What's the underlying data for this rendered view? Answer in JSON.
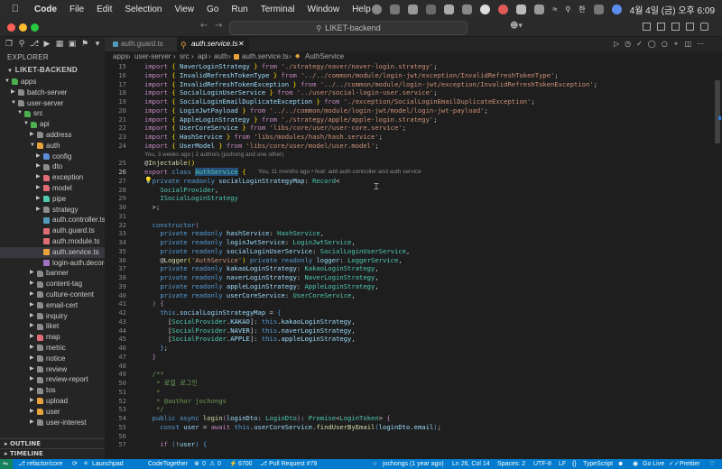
{
  "menubar": {
    "app": "Code",
    "items": [
      "File",
      "Edit",
      "Selection",
      "View",
      "Go",
      "Run",
      "Terminal",
      "Window",
      "Help"
    ],
    "clock": "4월 4일 (금) 오후 6:09"
  },
  "window": {
    "search": "LIKET-backend"
  },
  "sidebar": {
    "header": "EXPLORER",
    "project": "LIKET-BACKEND",
    "tree": [
      {
        "label": "apps",
        "depth": 0,
        "chevron": "open",
        "icon": "folder",
        "color": "#4caf50"
      },
      {
        "label": "batch-server",
        "depth": 1,
        "chevron": "closed",
        "icon": "folder",
        "color": "#8c8c8c"
      },
      {
        "label": "user-server",
        "depth": 1,
        "chevron": "open",
        "icon": "folder",
        "color": "#8c8c8c"
      },
      {
        "label": "src",
        "depth": 2,
        "chevron": "open",
        "icon": "folder",
        "color": "#4caf50"
      },
      {
        "label": "api",
        "depth": 3,
        "chevron": "open",
        "icon": "folder",
        "color": "#4caf50"
      },
      {
        "label": "address",
        "depth": 4,
        "chevron": "closed",
        "icon": "folder",
        "color": "#8c8c8c"
      },
      {
        "label": "auth",
        "depth": 4,
        "chevron": "open",
        "icon": "folder",
        "color": "#e8a33d"
      },
      {
        "label": "config",
        "depth": 5,
        "chevron": "closed",
        "icon": "folder",
        "color": "#5c8dd6"
      },
      {
        "label": "dto",
        "depth": 5,
        "chevron": "closed",
        "icon": "folder",
        "color": "#8c8c8c"
      },
      {
        "label": "exception",
        "depth": 5,
        "chevron": "closed",
        "icon": "folder",
        "color": "#e06c75"
      },
      {
        "label": "model",
        "depth": 5,
        "chevron": "closed",
        "icon": "folder",
        "color": "#e06c75"
      },
      {
        "label": "pipe",
        "depth": 5,
        "chevron": "closed",
        "icon": "folder",
        "color": "#4ec9b0"
      },
      {
        "label": "strategy",
        "depth": 5,
        "chevron": "closed",
        "icon": "folder",
        "color": "#8c8c8c"
      },
      {
        "label": "auth.controller.ts",
        "depth": 5,
        "chevron": "none",
        "icon": "file",
        "color": "#519aba"
      },
      {
        "label": "auth.guard.ts",
        "depth": 5,
        "chevron": "none",
        "icon": "file",
        "color": "#e06c75"
      },
      {
        "label": "auth.module.ts",
        "depth": 5,
        "chevron": "none",
        "icon": "file",
        "color": "#e06c75"
      },
      {
        "label": "auth.service.ts",
        "depth": 5,
        "chevron": "none",
        "icon": "file",
        "color": "#e8a33d",
        "selected": true
      },
      {
        "label": "login-auth.decora...",
        "depth": 5,
        "chevron": "none",
        "icon": "file",
        "color": "#a074c4"
      },
      {
        "label": "banner",
        "depth": 4,
        "chevron": "closed",
        "icon": "folder",
        "color": "#8c8c8c"
      },
      {
        "label": "content-tag",
        "depth": 4,
        "chevron": "closed",
        "icon": "folder",
        "color": "#8c8c8c"
      },
      {
        "label": "culture-content",
        "depth": 4,
        "chevron": "closed",
        "icon": "folder",
        "color": "#8c8c8c"
      },
      {
        "label": "email-cert",
        "depth": 4,
        "chevron": "closed",
        "icon": "folder",
        "color": "#8c8c8c"
      },
      {
        "label": "inquiry",
        "depth": 4,
        "chevron": "closed",
        "icon": "folder",
        "color": "#8c8c8c"
      },
      {
        "label": "liket",
        "depth": 4,
        "chevron": "closed",
        "icon": "folder",
        "color": "#8c8c8c"
      },
      {
        "label": "map",
        "depth": 4,
        "chevron": "closed",
        "icon": "folder",
        "color": "#e06c75"
      },
      {
        "label": "metric",
        "depth": 4,
        "chevron": "closed",
        "icon": "folder",
        "color": "#8c8c8c"
      },
      {
        "label": "notice",
        "depth": 4,
        "chevron": "closed",
        "icon": "folder",
        "color": "#8c8c8c"
      },
      {
        "label": "review",
        "depth": 4,
        "chevron": "closed",
        "icon": "folder",
        "color": "#8c8c8c"
      },
      {
        "label": "review-report",
        "depth": 4,
        "chevron": "closed",
        "icon": "folder",
        "color": "#8c8c8c"
      },
      {
        "label": "tos",
        "depth": 4,
        "chevron": "closed",
        "icon": "folder",
        "color": "#8c8c8c"
      },
      {
        "label": "upload",
        "depth": 4,
        "chevron": "closed",
        "icon": "folder",
        "color": "#e8a33d"
      },
      {
        "label": "user",
        "depth": 4,
        "chevron": "closed",
        "icon": "folder",
        "color": "#e8a33d"
      },
      {
        "label": "user-interest",
        "depth": 4,
        "chevron": "closed",
        "icon": "folder",
        "color": "#8c8c8c"
      }
    ],
    "outline": "OUTLINE",
    "timeline": "TIMELINE"
  },
  "tabs": [
    {
      "label": "auth.guard.ts",
      "active": false
    },
    {
      "label": "auth.service.ts",
      "active": true
    }
  ],
  "breadcrumb": [
    "apps",
    "user-server",
    "src",
    "api",
    "auth",
    "auth.service.ts",
    "AuthService"
  ],
  "blame_header": "You, 3 weeks ago | 2 authors (jochong and one other)",
  "inline_blame": "You, 11 months ago • feat: add auth controller and auth service",
  "lines": [
    {
      "n": "15",
      "html": "<span class=\"kc\">import</span> <span class=\"y\">{</span> <span class=\"v\">NaverLoginStrategy</span> <span class=\"y\">}</span> <span class=\"kc\">from</span> <span class=\"s\">'./strategy/naver/naver-login.strategy'</span>;"
    },
    {
      "n": "16",
      "html": "<span class=\"kc\">import</span> <span class=\"y\">{</span> <span class=\"v\">InvalidRefreshTokenType</span> <span class=\"y\">}</span> <span class=\"kc\">from</span> <span class=\"s\">'../../common/module/login-jwt/exception/InvalidRefreshTokenType'</span>;"
    },
    {
      "n": "17",
      "html": "<span class=\"kc\">import</span> <span class=\"y\">{</span> <span class=\"v\">InvalidRefreshTokenException</span> <span class=\"y\">}</span> <span class=\"kc\">from</span> <span class=\"s\">'../../common/module/login-jwt/exception/InvalidRefreshTokenException'</span>;"
    },
    {
      "n": "18",
      "html": "<span class=\"kc\">import</span> <span class=\"y\">{</span> <span class=\"v\">SocialLoginUserService</span> <span class=\"y\">}</span> <span class=\"kc\">from</span> <span class=\"s\">'../user/social-login-user.service'</span>;"
    },
    {
      "n": "19",
      "html": "<span class=\"kc\">import</span> <span class=\"y\">{</span> <span class=\"v\">SocialLoginEmailDuplicateException</span> <span class=\"y\">}</span> <span class=\"kc\">from</span> <span class=\"s\">'./exception/SocialLoginEmailDuplicateException'</span>;"
    },
    {
      "n": "20",
      "html": "<span class=\"kc\">import</span> <span class=\"y\">{</span> <span class=\"v\">LoginJwtPayload</span> <span class=\"y\">}</span> <span class=\"kc\">from</span> <span class=\"s\">'../../common/module/login-jwt/model/login-jwt-payload'</span>;"
    },
    {
      "n": "21",
      "html": "<span class=\"kc\">import</span> <span class=\"y\">{</span> <span class=\"v\">AppleLoginStrategy</span> <span class=\"y\">}</span> <span class=\"kc\">from</span> <span class=\"s\">'./strategy/apple/apple-login.strategy'</span>;"
    },
    {
      "n": "22",
      "html": "<span class=\"kc\">import</span> <span class=\"y\">{</span> <span class=\"v\">UserCoreService</span> <span class=\"y\">}</span> <span class=\"kc\">from</span> <span class=\"s\">'libs/core/user/user-core.service'</span>;"
    },
    {
      "n": "23",
      "html": "<span class=\"kc\">import</span> <span class=\"y\">{</span> <span class=\"v\">HashService</span> <span class=\"y\">}</span> <span class=\"kc\">from</span> <span class=\"s\">'libs/modules/hash/hash.service'</span>;"
    },
    {
      "n": "24",
      "html": "<span class=\"kc\">import</span> <span class=\"y\">{</span> <span class=\"v\">UserModel</span> <span class=\"y\">}</span> <span class=\"kc\">from</span> <span class=\"s\">'libs/core/user/model/user.model'</span>;"
    },
    {
      "n": "",
      "html": ""
    },
    {
      "n": "25",
      "html": "<span class=\"p\">@</span><span class=\"f\">Injectable</span><span class=\"y\">()</span>"
    },
    {
      "n": "26",
      "html": "<span class=\"kc\">export</span> <span class=\"k\">class</span> <span class=\"t\" style=\"background:#264f78\">AuthService</span> <span class=\"y\">{</span>"
    },
    {
      "n": "27",
      "html": "  <span class=\"k\">private</span> <span class=\"k\">readonly</span> <span class=\"v\">socialLoginStrategyMap</span>: <span class=\"t\">Record</span>&lt;"
    },
    {
      "n": "28",
      "html": "    <span class=\"t\">SocialProvider</span>,"
    },
    {
      "n": "29",
      "html": "    <span class=\"t\">ISocialLoginStrategy</span>"
    },
    {
      "n": "30",
      "html": "  &gt;;"
    },
    {
      "n": "31",
      "html": ""
    },
    {
      "n": "32",
      "html": "  <span class=\"k\">constructor</span><span class=\"kc\">(</span>"
    },
    {
      "n": "33",
      "html": "    <span class=\"k\">private</span> <span class=\"k\">readonly</span> <span class=\"v\">hashService</span>: <span class=\"t\">HashService</span>,"
    },
    {
      "n": "34",
      "html": "    <span class=\"k\">private</span> <span class=\"k\">readonly</span> <span class=\"v\">loginJwtService</span>: <span class=\"t\">LoginJwtService</span>,"
    },
    {
      "n": "35",
      "html": "    <span class=\"k\">private</span> <span class=\"k\">readonly</span> <span class=\"v\">socialLoginUserService</span>: <span class=\"t\">SocialLoginUserService</span>,"
    },
    {
      "n": "36",
      "html": "    <span class=\"p\">@</span><span class=\"f\">Logger</span><span class=\"y\">(</span><span class=\"s\">'AuthService'</span><span class=\"y\">)</span> <span class=\"k\">private</span> <span class=\"k\">readonly</span> <span class=\"v\">logger</span>: <span class=\"t\">LoggerService</span>,"
    },
    {
      "n": "37",
      "html": "    <span class=\"k\">private</span> <span class=\"k\">readonly</span> <span class=\"v\">kakaoLoginStrategy</span>: <span class=\"t\">KakaoLoginStrategy</span>,"
    },
    {
      "n": "38",
      "html": "    <span class=\"k\">private</span> <span class=\"k\">readonly</span> <span class=\"v\">naverLoginStrategy</span>: <span class=\"t\">NaverLoginStrategy</span>,"
    },
    {
      "n": "39",
      "html": "    <span class=\"k\">private</span> <span class=\"k\">readonly</span> <span class=\"v\">appleLoginStrategy</span>: <span class=\"t\">AppleLoginStrategy</span>,"
    },
    {
      "n": "40",
      "html": "    <span class=\"k\">private</span> <span class=\"k\">readonly</span> <span class=\"v\">userCoreService</span>: <span class=\"t\">UserCoreService</span>,"
    },
    {
      "n": "41",
      "html": "  <span class=\"kc\">)</span> <span class=\"kc\">{</span>"
    },
    {
      "n": "42",
      "html": "    <span class=\"k\">this</span>.<span class=\"v\">socialLoginStrategyMap</span> = <span class=\"k\">{</span>"
    },
    {
      "n": "43",
      "html": "      [<span class=\"t\">SocialProvider</span>.<span class=\"v\">KAKAO</span>]: <span class=\"k\">this</span>.<span class=\"v\">kakaoLoginStrategy</span>,"
    },
    {
      "n": "44",
      "html": "      [<span class=\"t\">SocialProvider</span>.<span class=\"v\">NAVER</span>]: <span class=\"k\">this</span>.<span class=\"v\">naverLoginStrategy</span>,"
    },
    {
      "n": "45",
      "html": "      [<span class=\"t\">SocialProvider</span>.<span class=\"v\">APPLE</span>]: <span class=\"k\">this</span>.<span class=\"v\">appleLoginStrategy</span>,"
    },
    {
      "n": "46",
      "html": "    <span class=\"k\">}</span>;"
    },
    {
      "n": "47",
      "html": "  <span class=\"kc\">}</span>"
    },
    {
      "n": "48",
      "html": ""
    },
    {
      "n": "49",
      "html": "  <span class=\"c\">/**</span>"
    },
    {
      "n": "50",
      "html": "  <span class=\"c\"> * 로컬 로그인</span>"
    },
    {
      "n": "51",
      "html": "  <span class=\"c\"> *</span>"
    },
    {
      "n": "52",
      "html": "  <span class=\"c\"> * @author jochongs</span>"
    },
    {
      "n": "53",
      "html": "  <span class=\"c\"> */</span>"
    },
    {
      "n": "54",
      "html": "  <span class=\"k\">public</span> <span class=\"k\">async</span> <span class=\"f\">login</span><span class=\"kc\">(</span><span class=\"v\">loginDto</span>: <span class=\"t\">LoginDto</span><span class=\"kc\">)</span>: <span class=\"t\">Promise</span>&lt;<span class=\"t\">LoginToken</span>&gt; <span class=\"kc\">{</span>"
    },
    {
      "n": "55",
      "html": "    <span class=\"k\">const</span> <span class=\"v\">user</span> = <span class=\"kc\">await</span> <span class=\"k\">this</span>.<span class=\"v\">userCoreService</span>.<span class=\"f\">findUserByEmail</span><span class=\"k\">(</span><span class=\"v\">loginDto</span>.<span class=\"v\">email</span><span class=\"k\">)</span>;"
    },
    {
      "n": "56",
      "html": ""
    },
    {
      "n": "57",
      "html": "    <span class=\"kc\">if</span> <span class=\"k\">(</span>!<span class=\"v\">user</span><span class=\"k\">)</span> <span class=\"k\">{</span>"
    }
  ],
  "status": {
    "branch": "refactor/core",
    "launchpad": "Launchpad",
    "codetogether": "CodeTogether",
    "errors": "0",
    "warnings": "0",
    "ports": "6700",
    "pr": "Pull Request #79",
    "blame": "jochongs (1 year ago)",
    "position": "Ln 26, Col 14",
    "spaces": "Spaces: 2",
    "encoding": "UTF-8",
    "eol": "LF",
    "language": "TypeScript",
    "golive": "Go Live",
    "prettier": "Prettier"
  }
}
